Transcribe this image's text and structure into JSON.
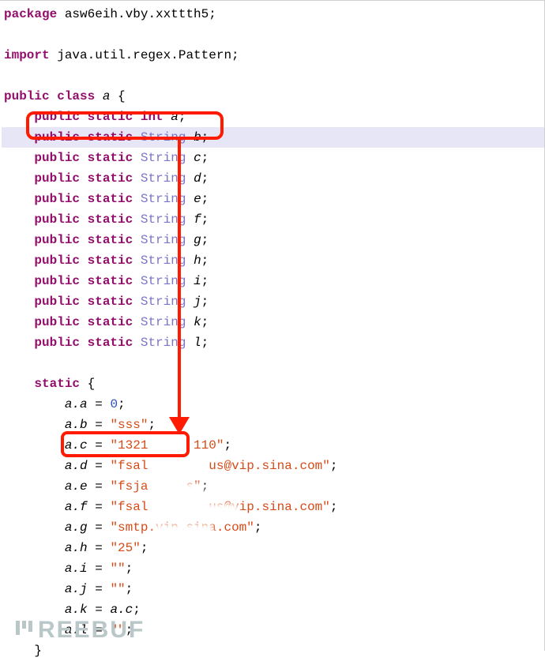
{
  "code": {
    "package_kw": "package",
    "package_name": " asw6eih.vby.xxttth5;",
    "import_kw": "import",
    "import_name": " java.util.regex.Pattern;",
    "public_kw": "public",
    "class_kw": "class",
    "static_kw": "static",
    "int_kw": "int",
    "string_type": "String",
    "class_name": " a ",
    "lbrace": "{",
    "rbrace": "}",
    "semicolon": ";",
    "fields": [
      {
        "type": "int",
        "name": "a"
      },
      {
        "type": "String",
        "name": "b"
      },
      {
        "type": "String",
        "name": "c"
      },
      {
        "type": "String",
        "name": "d"
      },
      {
        "type": "String",
        "name": "e"
      },
      {
        "type": "String",
        "name": "f"
      },
      {
        "type": "String",
        "name": "g"
      },
      {
        "type": "String",
        "name": "h"
      },
      {
        "type": "String",
        "name": "i"
      },
      {
        "type": "String",
        "name": "j"
      },
      {
        "type": "String",
        "name": "k"
      },
      {
        "type": "String",
        "name": "l"
      }
    ],
    "static_kw2": "static",
    "init_lines": [
      {
        "lhs": "a.a",
        "op": " = ",
        "rhs_type": "num",
        "rhs": "0",
        "semi": ";"
      },
      {
        "lhs": "a.b",
        "op": " = ",
        "rhs_type": "str",
        "rhs": "\"sss\"",
        "semi": ";"
      },
      {
        "lhs": "a.c",
        "op": " = ",
        "rhs_type": "str",
        "rhs": "\"1321      110\"",
        "semi": ";"
      },
      {
        "lhs": "a.d",
        "op": " = ",
        "rhs_type": "str",
        "rhs": "\"fsal        us@vip.sina.com\"",
        "semi": ";"
      },
      {
        "lhs": "a.e",
        "op": " = ",
        "rhs_type": "str",
        "rhs": "\"fsja     s\"",
        "semi": ";"
      },
      {
        "lhs": "a.f",
        "op": " = ",
        "rhs_type": "str",
        "rhs": "\"fsal        us@vip.sina.com\"",
        "semi": ";"
      },
      {
        "lhs": "a.g",
        "op": " = ",
        "rhs_type": "str",
        "rhs": "\"smtp.vip.sina.com\"",
        "semi": ";"
      },
      {
        "lhs": "a.h",
        "op": " = ",
        "rhs_type": "str",
        "rhs": "\"25\"",
        "semi": ";"
      },
      {
        "lhs": "a.i",
        "op": " = ",
        "rhs_type": "str",
        "rhs": "\"\"",
        "semi": ";"
      },
      {
        "lhs": "a.j",
        "op": " = ",
        "rhs_type": "str",
        "rhs": "\"\"",
        "semi": ";"
      },
      {
        "lhs": "a.k",
        "op": " = ",
        "rhs_type": "ident",
        "rhs": "a.c",
        "semi": ";"
      },
      {
        "lhs": "a.l",
        "op": " = ",
        "rhs_type": "str",
        "rhs": "\"\"",
        "semi": ";"
      }
    ]
  },
  "watermark": "REEBUF"
}
